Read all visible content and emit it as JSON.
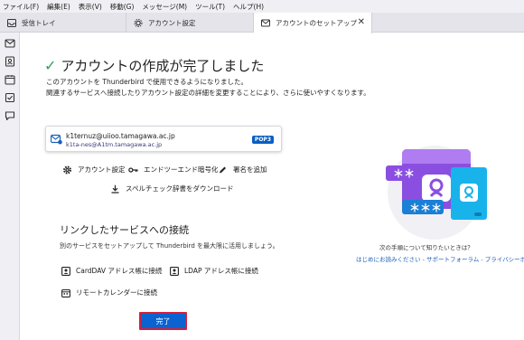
{
  "menubar": {
    "items": [
      "ファイル(F)",
      "編集(E)",
      "表示(V)",
      "移動(G)",
      "メッセージ(M)",
      "ツール(T)",
      "ヘルプ(H)"
    ]
  },
  "tabs": [
    {
      "label": "受信トレイ",
      "icon": "inbox-icon"
    },
    {
      "label": "アカウント設定",
      "icon": "account-settings-icon"
    },
    {
      "label": "アカウントのセットアップ",
      "icon": "mail-icon",
      "active": true,
      "close": "✕"
    }
  ],
  "spaces": [
    "mail-icon",
    "address-book-icon",
    "calendar-icon",
    "tasks-icon",
    "chat-icon"
  ],
  "main": {
    "check": "✓",
    "title": "アカウントの作成が完了しました",
    "intro_line1": "このアカウントを Thunderbird で使用できるようになりました。",
    "intro_line2": "関連するサービスへ接続したりアカウント設定の詳細を変更することにより、さらに使いやすくなります。",
    "account": {
      "email": "k1ternuz@uiioo.tamagawa.ac.jp",
      "sub": "k1ta-nes@A1tm.tamagawa.ac.jp",
      "badge": "POP3"
    },
    "actions": {
      "settings": "アカウント設定",
      "e2ee": "エンドツーエンド暗号化",
      "signature": "署名を追加",
      "dictionary": "スペルチェック辞書をダウンロード"
    },
    "services": {
      "heading": "リンクしたサービスへの接続",
      "desc": "別のサービスをセットアップして Thunderbird を最大限に活用しましょう。",
      "carddav": "CardDAV アドレス帳に接続",
      "ldap": "LDAP アドレス帳に接続",
      "calendar": "リモートカレンダーに接続"
    },
    "done": "完了",
    "help": {
      "question": "次の手順について知りたいときは？",
      "link1": "はじめにお読みください",
      "sep1": " - ",
      "link2": "サポートフォーラム",
      "sep2": " - ",
      "link3": "プライバシーポリシー"
    },
    "illustration": {
      "password_dots_1": "＊＊",
      "password_dots_2": "＊＊＊"
    }
  },
  "colors": {
    "accent": "#0a63d0",
    "success": "#2f9f4f",
    "focus_border": "#d4203a",
    "purple": "#8a4fe0",
    "cyan": "#19b3ec"
  }
}
